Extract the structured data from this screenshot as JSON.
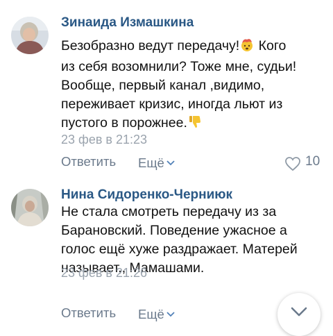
{
  "comments": [
    {
      "author": "Зинаида Измашкина",
      "lines": [
        "Безобразно ведут передачу!",
        "из себя возомнили? Тоже мне, судьи!",
        "Вообще, первый канал ,видимо,",
        "переживает кризис, иногда льют из",
        "пустого в порожнее."
      ],
      "line1_tail": " Кого",
      "date": "23 фев в 21:23",
      "reply_label": "Ответить",
      "more_label": "Ещё",
      "likes": "10",
      "emojis": [
        "exploding-head-emoji",
        "thumbs-down-emoji"
      ]
    },
    {
      "author": "Нина Сидоренко-Черниюк",
      "lines": [
        "Не стала смотреть передачу из за",
        "Барановский. Поведение ужасное а",
        "голос ещё хуже раздражает. Матерей",
        "называет,, Мамашами."
      ],
      "date": "23 фев в 21:26",
      "reply_label": "Ответить",
      "more_label": "Ещё"
    }
  ],
  "colors": {
    "author": "#2a5885",
    "text": "#111111",
    "meta": "#9aa3ad",
    "action": "#6b7a8c",
    "emoji": "#f5c431"
  },
  "icons": {
    "more_chevron": "chevron-down-icon",
    "like": "heart-icon",
    "scroll_down": "chevron-down-icon"
  }
}
